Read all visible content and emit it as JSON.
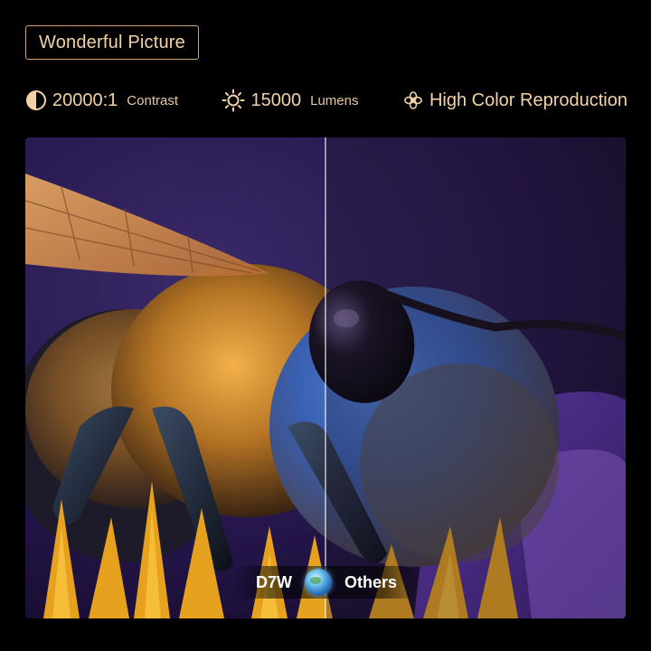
{
  "header": {
    "title": "Wonderful Picture"
  },
  "features": [
    {
      "icon": "contrast-icon",
      "value": "20000:1",
      "label": "Contrast"
    },
    {
      "icon": "sun-icon",
      "value": "15000",
      "label": "Lumens"
    },
    {
      "icon": "color-wheel-icon",
      "value": "High Color Reproduction",
      "label": ""
    }
  ],
  "comparison": {
    "left_label": "D7W",
    "right_label": "Others",
    "divider_icon": "globe-icon"
  },
  "colors": {
    "accent": "#f2d2a6",
    "border": "#c9a278",
    "background": "#000000"
  }
}
